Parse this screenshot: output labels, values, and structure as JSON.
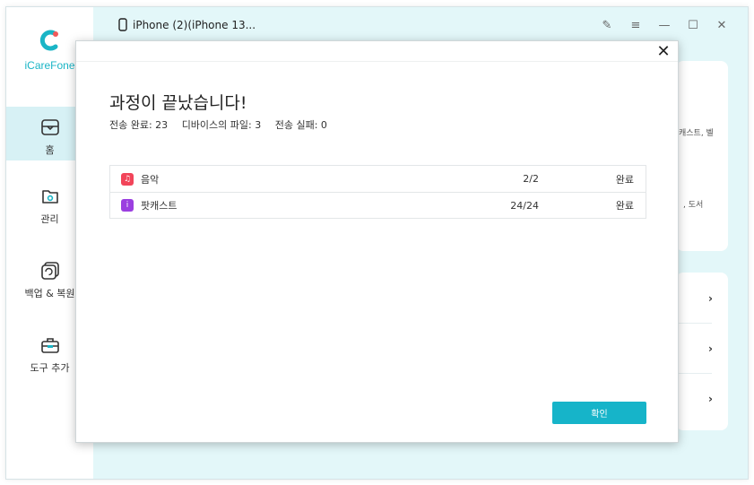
{
  "brand": {
    "name": "iCareFone"
  },
  "sidebar": {
    "items": [
      {
        "label": "홈",
        "active": true
      },
      {
        "label": "관리",
        "active": false
      },
      {
        "label": "백업 & 복원",
        "active": false
      },
      {
        "label": "도구 추가",
        "active": false
      }
    ]
  },
  "header": {
    "device": "iPhone (2)(iPhone 13..."
  },
  "background_fragments": {
    "line1": "캐스트, 벨",
    "line2": ", 도서"
  },
  "dialog": {
    "title": "과정이 끝났습니다!",
    "stats": {
      "transfer_done": "전송 완료: 23",
      "device_files": "디바이스의 파일: 3",
      "transfer_failed": "전송 실패: 0"
    },
    "rows": [
      {
        "name": "음악",
        "count": "2/2",
        "status": "완료",
        "icon_color": "#f2455a"
      },
      {
        "name": "팟캐스트",
        "count": "24/24",
        "status": "완료",
        "icon_color": "#9b3fe0"
      }
    ],
    "confirm_label": "확인"
  },
  "colors": {
    "accent": "#16b4c9",
    "active_nav": "#d7f1f5"
  }
}
